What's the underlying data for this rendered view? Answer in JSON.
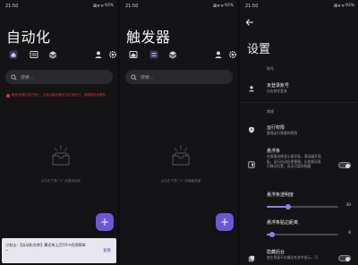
{
  "screens": [
    {
      "status": {
        "time": "21:50",
        "signal": "⊠ ▾ ᯤ",
        "battery": "93%"
      },
      "title": "自动化",
      "search_placeholder": "搜索...",
      "warning": "服务未绑定或已停止，当前功能可能无法正常运行，请重新启动服务。",
      "empty_text": "点击右下角 \"+\" 创建自动化",
      "fab_label": "+",
      "snackbar": {
        "message": "小贴士:【自动化仓库】最近有上百10+优质脚本~",
        "action": "查看"
      }
    },
    {
      "status": {
        "time": "21:50",
        "signal": "⊠ ▾ ᯤ",
        "battery": "93%"
      },
      "title": "触发器",
      "search_placeholder": "搜索...",
      "empty_text": "点击右下角 \"+\" 创建触发器",
      "fab_label": "+"
    },
    {
      "status": {
        "time": "21:50",
        "signal": "⊠ ▾ ᯤ",
        "battery": "93%"
      },
      "title": "设置",
      "account_section": "账号",
      "account_title": "未登录账号",
      "account_sub": "点击前往登录",
      "general_section": "常规",
      "permission_title": "运行权限",
      "permission_sub": "管理运行需要的权限",
      "float_title": "悬浮条",
      "float_sub": "在屏幕边缘显示悬浮条，滑动展开面板，运行自动化更便捷。长按悬浮条可移动位置，双击可暂时隐藏",
      "float_on": true,
      "transparency_title": "悬浮条透明度",
      "transparency_value": "30",
      "transparency_level": 0.3,
      "margin_title": "悬浮条贴边距离",
      "margin_value": "8",
      "margin_level": 0.08,
      "hide_title": "隐藏后台",
      "hide_sub": "使主界面不在最近任务中显示，可",
      "hide_on": true
    }
  ],
  "colors": {
    "accent": "#6f56d9",
    "warning": "#e0323a",
    "background": "#141416"
  },
  "icons": {
    "tab_home": "home-icon",
    "tab_list": "list-icon",
    "tab_layers": "layers-icon",
    "profile": "user-icon",
    "settings": "gear-icon",
    "search": "search-icon",
    "back": "back-arrow-icon",
    "fab": "plus-icon"
  }
}
